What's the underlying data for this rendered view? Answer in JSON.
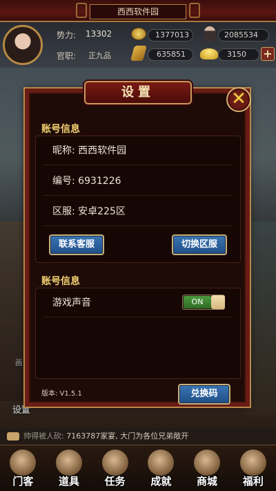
{
  "topbar": {
    "title": "西西软件园"
  },
  "player": {
    "power_label": "势力:",
    "power_value": "13302",
    "rank_label": "官职:",
    "rank_value": "正九品",
    "coins": "1377013",
    "soldiers": "2085534",
    "grain": "635851",
    "gold": "3150",
    "plus_label": "+"
  },
  "background": {
    "label_1": "画",
    "label_2": "设置"
  },
  "settings": {
    "title": "设置",
    "close_label": "✕",
    "account_section_title": "账号信息",
    "nickname_label": "昵称: 西西软件园",
    "id_label": "编号: 6931226",
    "server_label": "区服: 安卓225区",
    "contact_button": "联系客服",
    "switch_server_button": "切换区服",
    "sound_section_title": "账号信息",
    "sound_label": "游戏声音",
    "sound_toggle": "ON",
    "version": "版本: V1.5.1",
    "redeem_button": "兑换码"
  },
  "ticker": {
    "sender": "帅得被人砍:",
    "message": "7163787家宴, 大门为各位兄弟敞开"
  },
  "nav": {
    "items": [
      {
        "label": "门客"
      },
      {
        "label": "道具"
      },
      {
        "label": "任务"
      },
      {
        "label": "成就"
      },
      {
        "label": "商城"
      },
      {
        "label": "福利"
      }
    ]
  }
}
